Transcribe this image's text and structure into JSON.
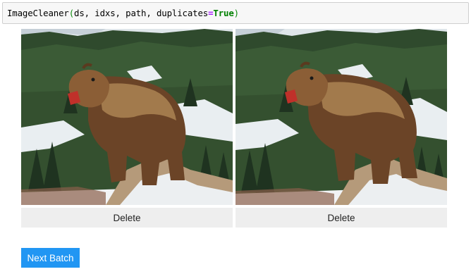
{
  "code_cell": {
    "func": "ImageCleaner",
    "open_paren": "(",
    "args": "ds, idxs, path, duplicates",
    "eq": "=",
    "kw_value": "True",
    "close_paren": ")"
  },
  "images": [
    {
      "subject": "grizzly bear roaring on rocky snowy slope",
      "delete_label": "Delete"
    },
    {
      "subject": "grizzly bear roaring on rocky snowy slope",
      "delete_label": "Delete"
    }
  ],
  "next_batch_label": "Next Batch",
  "colors": {
    "accent_button": "#2196f3",
    "delete_button_bg": "#eeeeee",
    "code_bg": "#f7f7f7"
  }
}
